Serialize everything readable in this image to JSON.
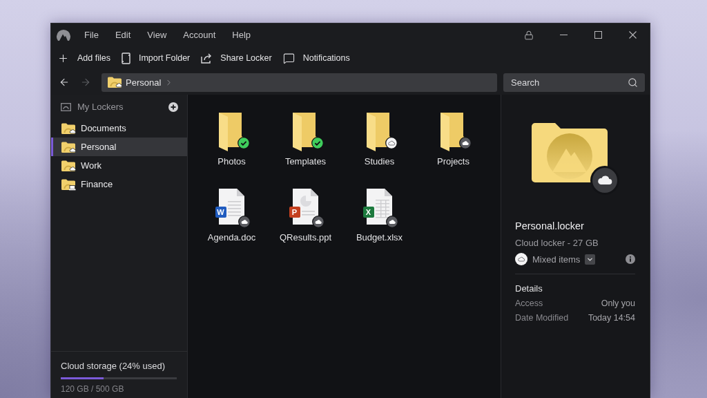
{
  "title_bar": {
    "menu": [
      "File",
      "Edit",
      "View",
      "Account",
      "Help"
    ]
  },
  "toolbar": [
    {
      "kind": "add",
      "label": "Add files"
    },
    {
      "kind": "import",
      "label": "Import Folder"
    },
    {
      "kind": "share",
      "label": "Share Locker"
    },
    {
      "kind": "notifications",
      "label": "Notifications"
    }
  ],
  "navigation": {
    "buttons": [
      {
        "kind": "back",
        "disabled": false
      },
      {
        "kind": "forward",
        "disabled": true
      }
    ],
    "path": [
      "Personal"
    ],
    "search": {
      "placeholder": "Search"
    }
  },
  "sidebar": {
    "header": "My Lockers",
    "items": [
      {
        "label": "Documents",
        "kind": "cloud",
        "selected": false
      },
      {
        "label": "Personal",
        "kind": "cloud",
        "selected": true
      },
      {
        "label": "Work",
        "kind": "cloud",
        "selected": false
      },
      {
        "label": "Finance",
        "kind": "local",
        "selected": false
      }
    ],
    "storage": {
      "label": "Cloud storage (24% used)",
      "level": 0.37,
      "reading": "120 GB / 500 GB"
    }
  },
  "files": [
    {
      "name": "Photos",
      "kind": "folder",
      "status": {
        "kind": "synced"
      }
    },
    {
      "name": "Templates",
      "kind": "folder",
      "status": {
        "kind": "synced"
      }
    },
    {
      "name": "Studies",
      "kind": "folder",
      "status": {
        "kind": "online"
      }
    },
    {
      "name": "Projects",
      "kind": "folder",
      "status": {
        "kind": "cloud"
      }
    },
    {
      "name": "Agenda.doc",
      "kind": "document",
      "letter": "W",
      "color": "#1f5bbf",
      "status": {
        "kind": "cloud"
      }
    },
    {
      "name": "QResults.ppt",
      "kind": "presentation",
      "letter": "P",
      "color": "#c4401f",
      "status": {
        "kind": "cloud"
      }
    },
    {
      "name": "Budget.xlsx",
      "kind": "spreadsheet",
      "letter": "X",
      "color": "#1d7a3e",
      "status": {
        "kind": "cloud"
      }
    }
  ],
  "details": {
    "title": "Personal.locker",
    "subtitle": "Cloud locker - 27 GB",
    "status": {
      "kind": "cloud"
    },
    "availability": "Mixed items",
    "section": "Details",
    "properties": [
      {
        "label": "Access",
        "value": "Only you"
      },
      {
        "label": "Date Modified",
        "value": "Today 14:54"
      }
    ]
  }
}
